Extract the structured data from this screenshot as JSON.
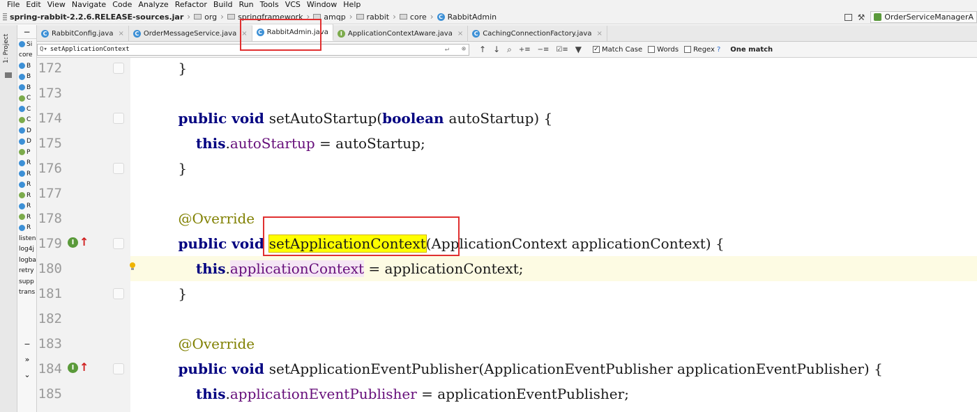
{
  "menu": [
    "File",
    "Edit",
    "View",
    "Navigate",
    "Code",
    "Analyze",
    "Refactor",
    "Build",
    "Run",
    "Tools",
    "VCS",
    "Window",
    "Help"
  ],
  "breadcrumbs": [
    {
      "label": "spring-rabbit-2.2.6.RELEASE-sources.jar",
      "icon": "jar-icon"
    },
    {
      "label": "org",
      "icon": "folder-icon"
    },
    {
      "label": "springframework",
      "icon": "folder-icon"
    },
    {
      "label": "amqp",
      "icon": "folder-icon"
    },
    {
      "label": "rabbit",
      "icon": "folder-icon"
    },
    {
      "label": "core",
      "icon": "folder-icon"
    },
    {
      "label": "RabbitAdmin",
      "icon": "class-icon"
    }
  ],
  "run_config": "OrderServiceManagerA",
  "toolwindow_label": "1: Project",
  "project_items": [
    {
      "label": "Si",
      "kind": "class"
    },
    {
      "label": "core",
      "kind": "text"
    },
    {
      "label": "B",
      "kind": "class"
    },
    {
      "label": "B",
      "kind": "class"
    },
    {
      "label": "B",
      "kind": "class"
    },
    {
      "label": "C",
      "kind": "interface"
    },
    {
      "label": "C",
      "kind": "class"
    },
    {
      "label": "C",
      "kind": "interface"
    },
    {
      "label": "D",
      "kind": "class"
    },
    {
      "label": "D",
      "kind": "class"
    },
    {
      "label": "P",
      "kind": "interface"
    },
    {
      "label": "R",
      "kind": "class"
    },
    {
      "label": "R",
      "kind": "class"
    },
    {
      "label": "R",
      "kind": "class"
    },
    {
      "label": "R",
      "kind": "interface"
    },
    {
      "label": "R",
      "kind": "class"
    },
    {
      "label": "R",
      "kind": "interface"
    },
    {
      "label": "R",
      "kind": "class"
    },
    {
      "label": "listen",
      "kind": "text"
    },
    {
      "label": "log4j",
      "kind": "text"
    },
    {
      "label": "logba",
      "kind": "text"
    },
    {
      "label": "retry",
      "kind": "text"
    },
    {
      "label": "supp",
      "kind": "text"
    },
    {
      "label": "trans",
      "kind": "text"
    }
  ],
  "tabs": [
    {
      "label": "RabbitConfig.java",
      "icon": "C",
      "active": false
    },
    {
      "label": "OrderMessageService.java",
      "icon": "C",
      "active": false
    },
    {
      "label": "RabbitAdmin.java",
      "icon": "C",
      "active": true
    },
    {
      "label": "ApplicationContextAware.java",
      "icon": "I",
      "active": false
    },
    {
      "label": "CachingConnectionFactory.java",
      "icon": "C",
      "active": false
    }
  ],
  "search": {
    "query": "setApplicationContext",
    "match_case_label": "Match Case",
    "match_case_checked": true,
    "words_label": "Words",
    "regex_label": "Regex",
    "help": "?",
    "result": "One match"
  },
  "colors": {
    "keyword": "#000080",
    "field": "#660e7a",
    "annotation": "#808000",
    "search_hit": "#ffff00",
    "annotation_box": "#e03030"
  },
  "code_lines": [
    {
      "num": "172",
      "marker": false,
      "parts": [
        {
          "t": "    }",
          "c": "plain"
        }
      ]
    },
    {
      "num": "173",
      "marker": false,
      "parts": []
    },
    {
      "num": "174",
      "marker": false,
      "parts": [
        {
          "t": "    ",
          "c": "plain"
        },
        {
          "t": "public void ",
          "c": "kw"
        },
        {
          "t": "setAutoStartup(",
          "c": "plain"
        },
        {
          "t": "boolean ",
          "c": "kw"
        },
        {
          "t": "autoStartup) {",
          "c": "plain"
        }
      ]
    },
    {
      "num": "175",
      "marker": false,
      "parts": [
        {
          "t": "        ",
          "c": "plain"
        },
        {
          "t": "this",
          "c": "kw"
        },
        {
          "t": ".",
          "c": "plain"
        },
        {
          "t": "autoStartup",
          "c": "fld"
        },
        {
          "t": " = autoStartup;",
          "c": "plain"
        }
      ]
    },
    {
      "num": "176",
      "marker": false,
      "parts": [
        {
          "t": "    }",
          "c": "plain"
        }
      ]
    },
    {
      "num": "177",
      "marker": false,
      "parts": []
    },
    {
      "num": "178",
      "marker": false,
      "parts": [
        {
          "t": "    ",
          "c": "plain"
        },
        {
          "t": "@Override",
          "c": "ann"
        }
      ]
    },
    {
      "num": "179",
      "marker": true,
      "parts": [
        {
          "t": "    ",
          "c": "plain"
        },
        {
          "t": "public void ",
          "c": "kw"
        },
        {
          "t": "setApplicationContext",
          "c": "hit"
        },
        {
          "t": "(ApplicationContext applicationContext) {",
          "c": "plain"
        }
      ]
    },
    {
      "num": "180",
      "marker": false,
      "parts": [
        {
          "t": "        ",
          "c": "plain"
        },
        {
          "t": "this",
          "c": "kw"
        },
        {
          "t": ".",
          "c": "plain"
        },
        {
          "t": "applicationContext",
          "c": "fldhl"
        },
        {
          "t": " = applicationContext;",
          "c": "plain"
        }
      ]
    },
    {
      "num": "181",
      "marker": false,
      "parts": [
        {
          "t": "    }",
          "c": "plain"
        }
      ]
    },
    {
      "num": "182",
      "marker": false,
      "parts": []
    },
    {
      "num": "183",
      "marker": false,
      "parts": [
        {
          "t": "    ",
          "c": "plain"
        },
        {
          "t": "@Override",
          "c": "ann"
        }
      ]
    },
    {
      "num": "184",
      "marker": true,
      "parts": [
        {
          "t": "    ",
          "c": "plain"
        },
        {
          "t": "public void ",
          "c": "kw"
        },
        {
          "t": "setApplicationEventPublisher(ApplicationEventPublisher applicationEventPublisher) {",
          "c": "plain"
        }
      ]
    },
    {
      "num": "185",
      "marker": false,
      "parts": [
        {
          "t": "        ",
          "c": "plain"
        },
        {
          "t": "this",
          "c": "kw"
        },
        {
          "t": ".",
          "c": "plain"
        },
        {
          "t": "applicationEventPublisher",
          "c": "fld"
        },
        {
          "t": " = applicationEventPublisher;",
          "c": "plain"
        }
      ]
    }
  ],
  "folds": [
    "172",
    "174",
    "176",
    "179",
    "181",
    "184"
  ],
  "bulb_line": "180"
}
